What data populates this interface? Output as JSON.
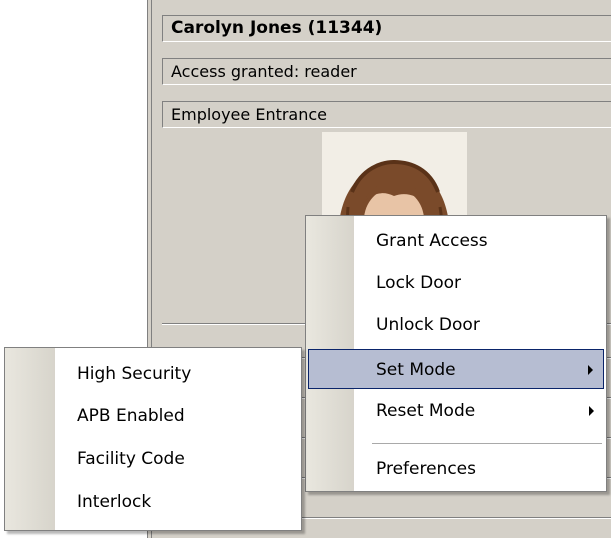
{
  "cardholder": {
    "name": "Carolyn Jones (11344)",
    "status": "Access granted: reader",
    "door": "Employee Entrance"
  },
  "context_menu": {
    "items": [
      {
        "label": "Grant Access"
      },
      {
        "label": "Lock Door"
      },
      {
        "label": "Unlock Door"
      },
      {
        "label": "Set Mode",
        "submenu": true,
        "highlighted": true
      },
      {
        "label": "Reset Mode",
        "submenu": true
      },
      {
        "label": "Preferences"
      }
    ]
  },
  "set_mode_submenu": {
    "items": [
      {
        "label": "High Security"
      },
      {
        "label": "APB Enabled"
      },
      {
        "label": "Facility Code"
      },
      {
        "label": "Interlock"
      }
    ]
  },
  "colors": {
    "panel": "#d4d0c8",
    "highlight": "#b6bdd2",
    "highlight_border": "#0a246a"
  }
}
